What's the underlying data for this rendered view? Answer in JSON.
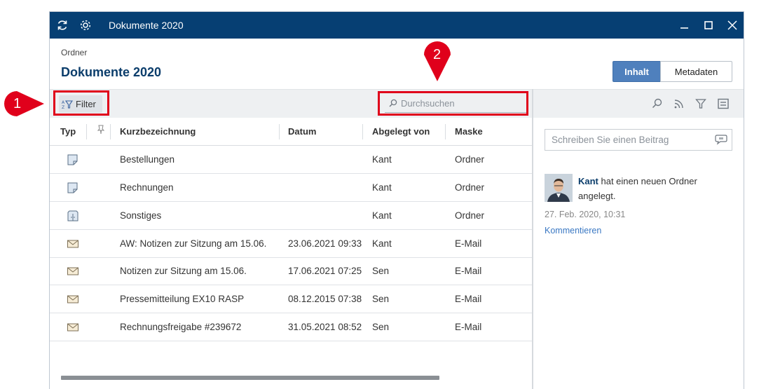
{
  "titlebar": {
    "title": "Dokumente 2020",
    "icons": [
      "refresh-icon",
      "gear-icon",
      "minimize-icon",
      "maximize-icon",
      "close-icon"
    ]
  },
  "header": {
    "breadcrumb": "Ordner",
    "title": "Dokumente 2020",
    "tabs": [
      {
        "label": "Inhalt",
        "active": true
      },
      {
        "label": "Metadaten",
        "active": false
      }
    ]
  },
  "toolbar": {
    "filter_label": "Filter",
    "search_placeholder": "Durchsuchen"
  },
  "table": {
    "columns": [
      "Typ",
      "",
      "Kurzbezeichnung",
      "Datum",
      "Abgelegt von",
      "Maske"
    ],
    "rows": [
      {
        "icon": "folder-icon",
        "name": "Bestellungen",
        "date": "",
        "by": "Kant",
        "mask": "Ordner"
      },
      {
        "icon": "folder-icon",
        "name": "Rechnungen",
        "date": "",
        "by": "Kant",
        "mask": "Ordner"
      },
      {
        "icon": "cabinet-folder-icon",
        "name": "Sonstiges",
        "date": "",
        "by": "Kant",
        "mask": "Ordner"
      },
      {
        "icon": "mail-icon",
        "name": "AW: Notizen zur Sitzung am 15.06.",
        "date": "23.06.2021 09:33",
        "by": "Kant",
        "mask": "E-Mail"
      },
      {
        "icon": "mail-icon",
        "name": "Notizen zur Sitzung am 15.06.",
        "date": "17.06.2021 07:25",
        "by": "Sen",
        "mask": "E-Mail"
      },
      {
        "icon": "mail-icon",
        "name": "Pressemitteilung EX10 RASP",
        "date": "08.12.2015 07:38",
        "by": "Sen",
        "mask": "E-Mail"
      },
      {
        "icon": "mail-icon",
        "name": "Rechnungsfreigabe #239672",
        "date": "31.05.2021 08:52",
        "by": "Sen",
        "mask": "E-Mail"
      }
    ]
  },
  "feed": {
    "post_placeholder": "Schreiben Sie einen Beitrag",
    "entry": {
      "user": "Kant",
      "text": " hat einen neuen Ordner angelegt.",
      "date": "27. Feb. 2020, 10:31",
      "comment_label": "Kommentieren"
    }
  },
  "annotations": {
    "marker1": "1",
    "marker2": "2",
    "color": "#e0001b"
  },
  "colors": {
    "titlebar": "#063f73",
    "accent": "#4f80bd",
    "title_text": "#0b3d6b"
  }
}
